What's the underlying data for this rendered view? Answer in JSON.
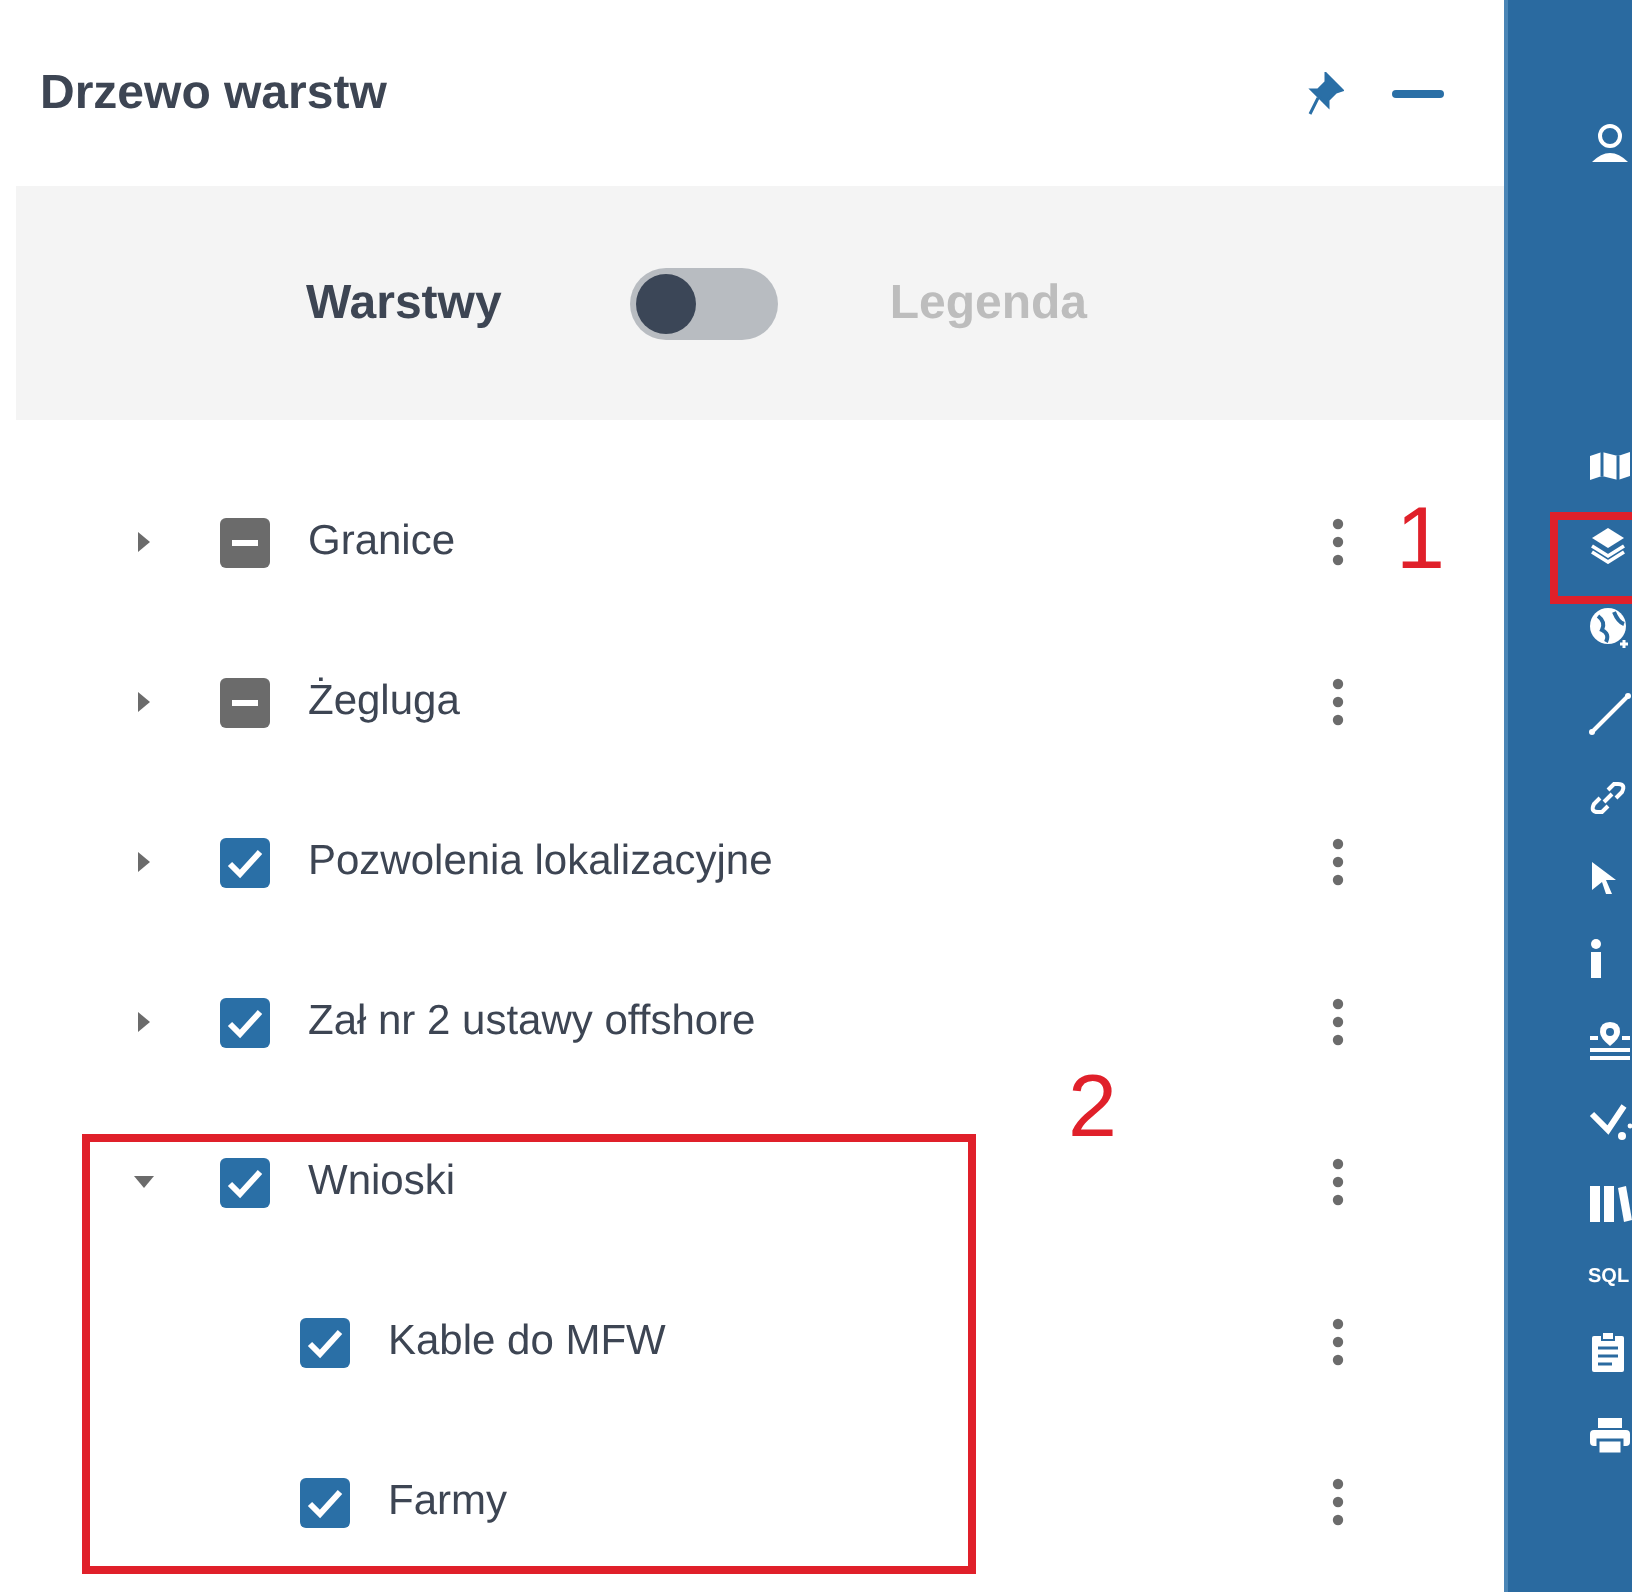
{
  "panel": {
    "title": "Drzewo warstw"
  },
  "view_switch": {
    "left_label": "Warstwy",
    "right_label": "Legenda",
    "on": false
  },
  "layers": [
    {
      "label": "Granice",
      "expanded": false,
      "partial": true
    },
    {
      "label": "Żegluga",
      "expanded": false,
      "partial": true
    },
    {
      "label": "Pozwolenia lokalizacyjne",
      "expanded": false,
      "checked": true
    },
    {
      "label": "Zał nr 2 ustawy offshore",
      "expanded": false,
      "checked": true
    },
    {
      "label": "Wnioski",
      "expanded": true,
      "checked": true,
      "children": [
        {
          "label": "Kable do MFW",
          "checked": true
        },
        {
          "label": "Farmy",
          "checked": true
        }
      ]
    }
  ],
  "toolbar": {
    "sql_label": "SQL"
  },
  "annotations": [
    {
      "label": "1"
    },
    {
      "label": "2"
    }
  ]
}
